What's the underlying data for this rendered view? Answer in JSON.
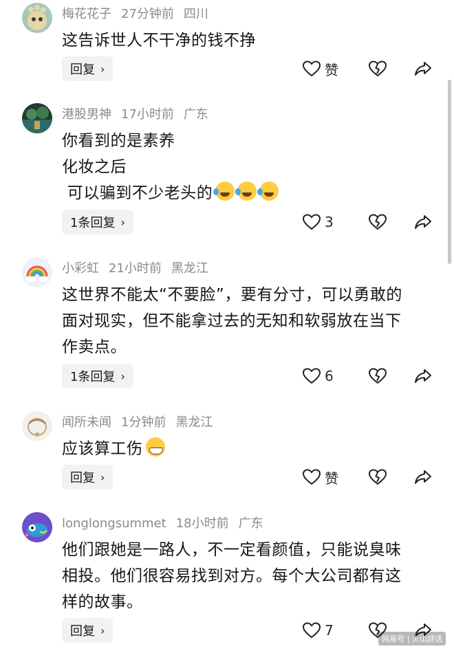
{
  "comments": [
    {
      "username": "梅花花子",
      "time": "27分钟前",
      "location": "四川",
      "lines": [
        "这告诉世人不干净的钱不挣"
      ],
      "reply_label": "回复",
      "like_count": "赞"
    },
    {
      "username": "港股男神",
      "time": "17小时前",
      "location": "广东",
      "lines": [
        "你看到的是素养",
        "化妆之后",
        " 可以骗到不少老头的"
      ],
      "reply_label": "1条回复",
      "like_count": "3"
    },
    {
      "username": "小彩虹",
      "time": "21小时前",
      "location": "黑龙江",
      "lines": [
        "这世界不能太“不要脸”，要有分寸，可以勇敢的",
        "面对现实，但不能拿过去的无知和软弱放在当下",
        "作卖点。"
      ],
      "reply_label": "1条回复",
      "like_count": "6"
    },
    {
      "username": "闻所未闻",
      "time": "1分钟前",
      "location": "黑龙江",
      "lines": [
        "应该算工伤"
      ],
      "reply_label": "回复",
      "like_count": "赞"
    },
    {
      "username": "longlongsummet",
      "time": "18小时前",
      "location": "广东",
      "lines": [
        "他们跟她是一路人，不一定看颜值，只能说臭味",
        "相投。他们很容易找到对方。每个大公司都有这",
        "样的故事。"
      ],
      "reply_label": "回复",
      "like_count": "7"
    }
  ],
  "icons": {
    "reply_chevron": "chevron-right-icon",
    "like": "heart-icon",
    "dislike": "broken-heart-icon",
    "share": "share-arrow-icon"
  },
  "watermark": "网易号 | 火山詩话"
}
